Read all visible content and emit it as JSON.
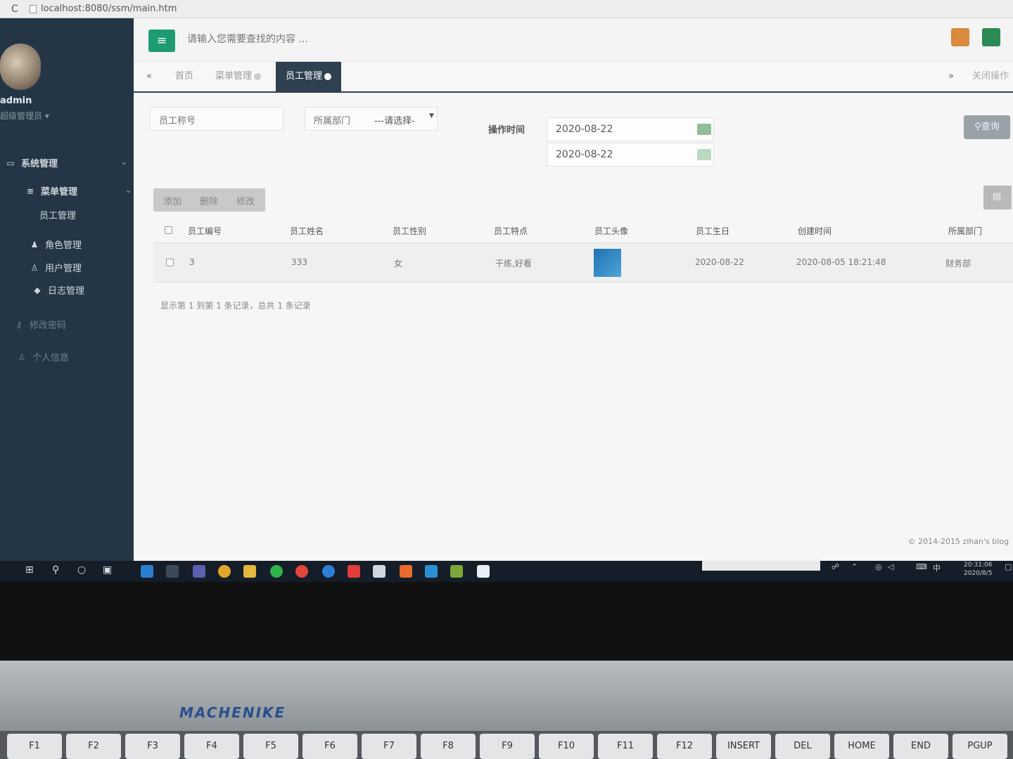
{
  "browser": {
    "url": "localhost:8080/ssm/main.htm"
  },
  "user": {
    "name": "admin",
    "role": "超级管理员"
  },
  "sidebar": {
    "items": [
      {
        "label": "系统管理",
        "icon": "monitor-icon",
        "level": 1
      },
      {
        "label": "菜单管理",
        "icon": "sliders-icon",
        "level": 2
      },
      {
        "label": "员工管理",
        "icon": "",
        "level": 3
      },
      {
        "label": "角色管理",
        "icon": "users-icon",
        "level": 2
      },
      {
        "label": "用户管理",
        "icon": "user-icon",
        "level": 2
      },
      {
        "label": "日志管理",
        "icon": "tag-icon",
        "level": 2
      },
      {
        "label": "修改密码",
        "icon": "key-icon",
        "level": 1
      },
      {
        "label": "个人信息",
        "icon": "person-icon",
        "level": 1
      }
    ]
  },
  "header": {
    "search_placeholder": "请输入您需要查找的内容 ..."
  },
  "tabs": [
    {
      "label": "首页",
      "closable": false,
      "active": false
    },
    {
      "label": "菜单管理",
      "closable": true,
      "active": false
    },
    {
      "label": "员工管理",
      "closable": true,
      "active": true
    }
  ],
  "tabs_right": {
    "close_ops": "关闭操作"
  },
  "filters": {
    "employee_no_label": "员工称号",
    "dept_label": "所属部门",
    "dept_selected": "---请选择-",
    "op_time_label": "操作时间",
    "date_from": "2020-08-22",
    "date_to": "2020-08-22",
    "query_label": "查询"
  },
  "toolbar": {
    "add": "添加",
    "delete": "删除",
    "edit": "修改"
  },
  "table": {
    "headers": [
      "员工编号",
      "员工姓名",
      "员工性别",
      "员工特点",
      "员工头像",
      "员工生日",
      "创建时间",
      "所属部门"
    ],
    "rows": [
      [
        "3",
        "333",
        "女",
        "干练,好看",
        "",
        "2020-08-22",
        "2020-08-05 18:21:48",
        "财务部"
      ]
    ]
  },
  "pagination": {
    "text": "显示第 1 到第 1 条记录，总共 1 条记录"
  },
  "footer": {
    "copyright": "© 2014-2015 zihan's blog"
  },
  "taskbar": {
    "time": "20:31:06",
    "date": "2020/8/5",
    "ime": "中"
  },
  "laptop": {
    "brand": "MACHENIKE",
    "keys": [
      "F1",
      "F2",
      "F3",
      "F4",
      "F5",
      "F6",
      "F7",
      "F8",
      "F9",
      "F10",
      "F11",
      "F12",
      "INSERT",
      "DEL",
      "HOME",
      "END",
      "PGUP"
    ]
  },
  "colors": {
    "accent_green": "#1d9c73",
    "sidebar_bg": "#243646",
    "active_tab": "#2f4050"
  }
}
